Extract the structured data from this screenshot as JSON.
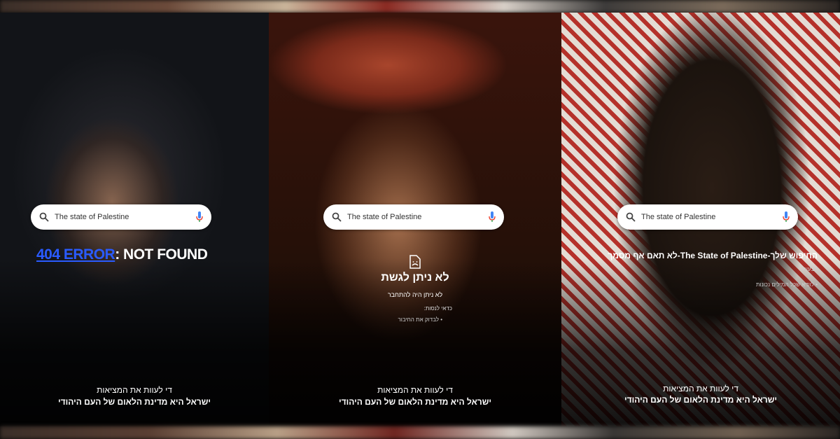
{
  "search_query": "The state of Palestine",
  "panels": {
    "left": {
      "error_code": "404 ERROR",
      "error_text": ": NOT FOUND"
    },
    "middle": {
      "heading": "לא ניתן לגשת",
      "subtext": "לא ניתן היה להתחבר",
      "try_label": "כדאי לנסות:",
      "bullet": "לבדוק את החיבור"
    },
    "right": {
      "result_title": "החיפוש שלך-The State of Palestine-לא תאם אף מסמך",
      "suggestions_label": "הצעות",
      "bullet": "לוודא שכל המילים נכונות"
    }
  },
  "footer": {
    "line1": "די לעוות את המציאות",
    "line2": "ישראל היא מדינת הלאום של העם היהודי"
  },
  "colors": {
    "error_blue": "#2a5bff",
    "mic_blue": "#4285f4",
    "mic_red": "#ea4335"
  }
}
